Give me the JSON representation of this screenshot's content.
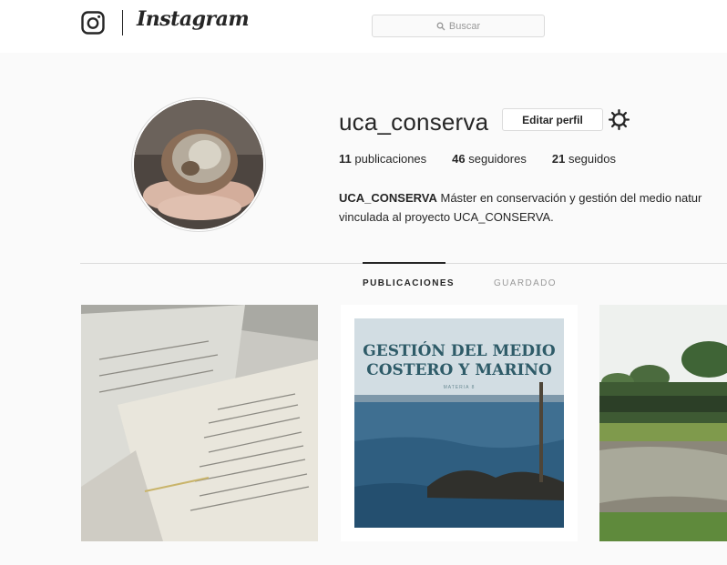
{
  "nav": {
    "brand": "Instagram",
    "search_placeholder": "Buscar"
  },
  "profile": {
    "username": "uca_conserva",
    "edit_button": "Editar perfil",
    "stats": {
      "posts_count": "11",
      "posts_label": "publicaciones",
      "followers_count": "46",
      "followers_label": "seguidores",
      "following_count": "21",
      "following_label": "seguidos"
    },
    "bio": {
      "name": "UCA_CONSERVA",
      "line1_rest": " Máster en conservación y gestión del medio natur",
      "line2": "vinculada al proyecto UCA_CONSERVA."
    }
  },
  "tabs": [
    {
      "label": "PUBLICACIONES",
      "active": true
    },
    {
      "label": "GUARDADO",
      "active": false
    }
  ],
  "posts": [
    {
      "kind": "photo",
      "subject": "printed pages"
    },
    {
      "kind": "graphic",
      "title_line1": "GESTIÓN DEL MEDIO",
      "title_line2": "COSTERO Y MARINO",
      "subtitle": "MATERIA 8"
    },
    {
      "kind": "photo",
      "subject": "wetland landscape"
    }
  ],
  "colors": {
    "text": "#262626",
    "muted": "#999999",
    "border": "#dbdbdb",
    "background": "#fafafa",
    "post_title": "#2e5b68"
  },
  "icons": {
    "logo": "instagram-camera-icon",
    "search": "search-icon",
    "settings": "gear-icon"
  }
}
